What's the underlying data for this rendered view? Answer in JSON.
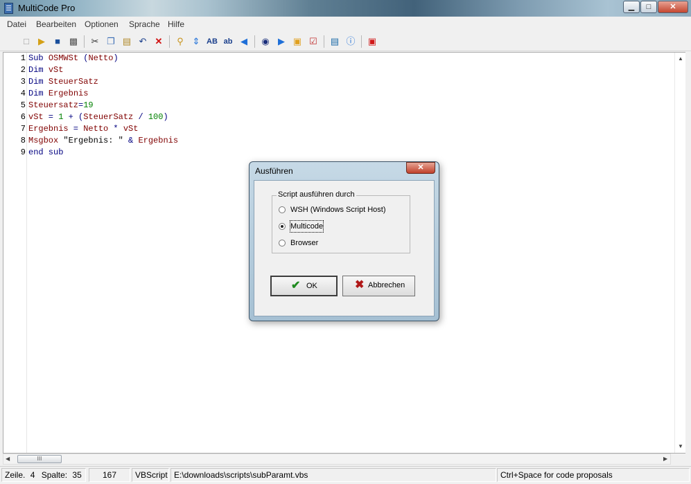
{
  "window": {
    "title": "MultiCode Pro",
    "min_glyph": "▁",
    "max_glyph": "□",
    "close_glyph": "✕"
  },
  "menu": [
    "Datei",
    "Bearbeiten",
    "Optionen",
    "Sprache",
    "Hilfe"
  ],
  "toolbar": {
    "icons": [
      "new-file-icon",
      "open-folder-icon",
      "save-icon",
      "print-icon",
      "cut-icon",
      "copy-icon",
      "paste-icon",
      "undo-icon",
      "delete-icon",
      "find-icon",
      "goto-icon",
      "uppercase-icon",
      "lowercase-icon",
      "first-icon",
      "run-script-icon",
      "play-icon",
      "folder-icon",
      "checklist-icon",
      "book-icon",
      "info-icon",
      "exit-icon"
    ],
    "uppercase_label": "AB",
    "lowercase_label": "ab"
  },
  "editor": {
    "line_numbers": [
      "1",
      "2",
      "3",
      "4",
      "5",
      "6",
      "7",
      "8",
      "9"
    ],
    "lines": [
      [
        {
          "t": "Sub ",
          "c": "kw"
        },
        {
          "t": "OSMWSt",
          "c": "id"
        },
        {
          "t": " (",
          "c": "kw"
        },
        {
          "t": "Netto",
          "c": "id"
        },
        {
          "t": ")",
          "c": "kw"
        }
      ],
      [
        {
          "t": "Dim ",
          "c": "kw"
        },
        {
          "t": "vSt",
          "c": "id"
        }
      ],
      [
        {
          "t": "Dim ",
          "c": "kw"
        },
        {
          "t": "SteuerSatz",
          "c": "id"
        }
      ],
      [
        {
          "t": "Dim ",
          "c": "kw"
        },
        {
          "t": "Ergebnis",
          "c": "id"
        }
      ],
      [
        {
          "t": "Steuersatz",
          "c": "id"
        },
        {
          "t": "=",
          "c": "kw"
        },
        {
          "t": "19",
          "c": "num"
        }
      ],
      [
        {
          "t": "vSt",
          "c": "id"
        },
        {
          "t": " = ",
          "c": "kw"
        },
        {
          "t": "1",
          "c": "num"
        },
        {
          "t": " + (",
          "c": "kw"
        },
        {
          "t": "SteuerSatz",
          "c": "id"
        },
        {
          "t": " / ",
          "c": "kw"
        },
        {
          "t": "100",
          "c": "num"
        },
        {
          "t": ")",
          "c": "kw"
        }
      ],
      [
        {
          "t": "Ergebnis",
          "c": "id"
        },
        {
          "t": " = ",
          "c": "kw"
        },
        {
          "t": "Netto",
          "c": "id"
        },
        {
          "t": " * ",
          "c": "kw"
        },
        {
          "t": "vSt",
          "c": "id"
        }
      ],
      [
        {
          "t": "Msgbox ",
          "c": "id"
        },
        {
          "t": "\"Ergebnis: \"",
          "c": "str"
        },
        {
          "t": " & ",
          "c": "kw"
        },
        {
          "t": "Ergebnis",
          "c": "id"
        }
      ],
      [
        {
          "t": "end sub",
          "c": "kw"
        }
      ]
    ],
    "hscroll_grip": "III"
  },
  "dialog": {
    "title": "Ausführen",
    "close_glyph": "✕",
    "group_label": "Script ausführen durch",
    "options": [
      {
        "label": "WSH (Windows Script Host)",
        "checked": false
      },
      {
        "label": "Multicode",
        "checked": true
      },
      {
        "label": "Browser",
        "checked": false
      }
    ],
    "ok_label": "OK",
    "ok_glyph": "✔",
    "cancel_label": "Abbrechen",
    "cancel_glyph": "✖",
    "ok_color": "#1f8a1f",
    "cancel_color": "#b01818"
  },
  "status": {
    "line_label": "Zeile.",
    "line_value": "4",
    "col_label": "Spalte:",
    "col_value": "35",
    "count": "167",
    "language": "VBScript",
    "path": "E:\\downloads\\scripts\\subParamt.vbs",
    "hint": "Ctrl+Space for code proposals"
  }
}
